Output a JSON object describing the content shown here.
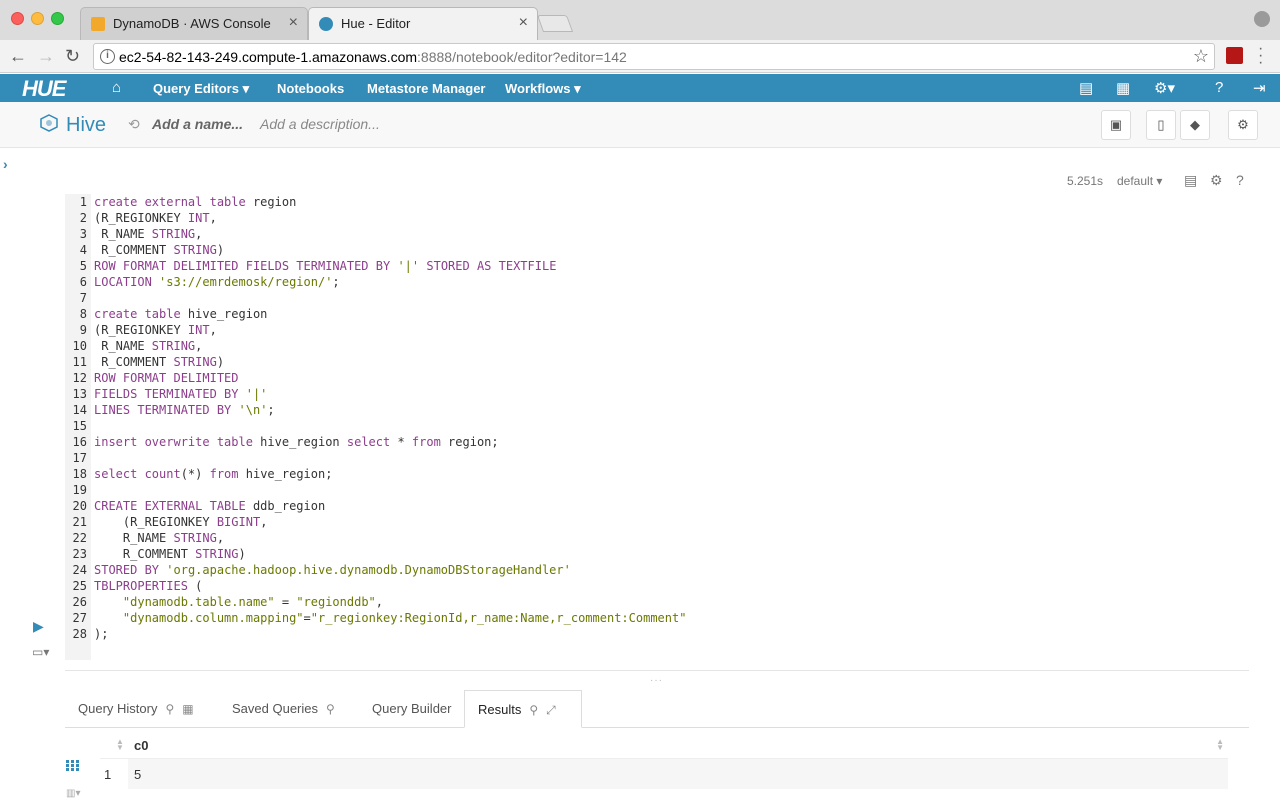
{
  "browser": {
    "tabs": [
      {
        "label": "DynamoDB · AWS Console",
        "icon": "aws-cube-icon"
      },
      {
        "label": "Hue - Editor",
        "icon": "hue-icon"
      }
    ],
    "url_host": "ec2-54-82-143-249.compute-1.amazonaws.com",
    "url_rest": ":8888/notebook/editor?editor=142"
  },
  "hue_nav": {
    "logo": "HUE",
    "items": [
      "Query Editors",
      "Notebooks",
      "Metastore Manager",
      "Workflows"
    ]
  },
  "editor": {
    "title": "Hive",
    "name_placeholder": "Add a name...",
    "description_placeholder": "Add a description..."
  },
  "snippet": {
    "elapsed": "5.251s",
    "database": "default"
  },
  "code_lines": [
    [
      [
        "kw",
        "create external table"
      ],
      [
        "t",
        " region"
      ]
    ],
    [
      [
        "t",
        "(R_REGIONKEY "
      ],
      [
        "kw",
        "INT"
      ],
      [
        "t",
        ","
      ]
    ],
    [
      [
        "t",
        " R_NAME "
      ],
      [
        "kw",
        "STRING"
      ],
      [
        "t",
        ","
      ]
    ],
    [
      [
        "t",
        " R_COMMENT "
      ],
      [
        "kw",
        "STRING"
      ],
      [
        "t",
        ")"
      ]
    ],
    [
      [
        "kw",
        "ROW FORMAT DELIMITED FIELDS TERMINATED BY"
      ],
      [
        "t",
        " "
      ],
      [
        "str",
        "'|'"
      ],
      [
        "t",
        " "
      ],
      [
        "kw",
        "STORED AS TEXTFILE"
      ]
    ],
    [
      [
        "kw",
        "LOCATION"
      ],
      [
        "t",
        " "
      ],
      [
        "str",
        "'s3://emrdemosk/region/'"
      ],
      [
        "t",
        ";"
      ]
    ],
    [],
    [
      [
        "kw",
        "create table"
      ],
      [
        "t",
        " hive_region"
      ]
    ],
    [
      [
        "t",
        "(R_REGIONKEY "
      ],
      [
        "kw",
        "INT"
      ],
      [
        "t",
        ","
      ]
    ],
    [
      [
        "t",
        " R_NAME "
      ],
      [
        "kw",
        "STRING"
      ],
      [
        "t",
        ","
      ]
    ],
    [
      [
        "t",
        " R_COMMENT "
      ],
      [
        "kw",
        "STRING"
      ],
      [
        "t",
        ")"
      ]
    ],
    [
      [
        "kw",
        "ROW FORMAT DELIMITED"
      ]
    ],
    [
      [
        "kw",
        "FIELDS TERMINATED BY"
      ],
      [
        "t",
        " "
      ],
      [
        "str",
        "'|'"
      ]
    ],
    [
      [
        "kw",
        "LINES TERMINATED BY"
      ],
      [
        "t",
        " "
      ],
      [
        "str",
        "'\\n'"
      ],
      [
        "t",
        ";"
      ]
    ],
    [],
    [
      [
        "kw",
        "insert overwrite table"
      ],
      [
        "t",
        " hive_region "
      ],
      [
        "kw",
        "select"
      ],
      [
        "t",
        " * "
      ],
      [
        "kw",
        "from"
      ],
      [
        "t",
        " region;"
      ]
    ],
    [],
    [
      [
        "kw",
        "select count"
      ],
      [
        "t",
        "(*) "
      ],
      [
        "kw",
        "from"
      ],
      [
        "t",
        " hive_region;"
      ]
    ],
    [],
    [
      [
        "kw",
        "CREATE EXTERNAL TABLE"
      ],
      [
        "t",
        " ddb_region"
      ]
    ],
    [
      [
        "t",
        "    (R_REGIONKEY "
      ],
      [
        "kw",
        "BIGINT"
      ],
      [
        "t",
        ","
      ]
    ],
    [
      [
        "t",
        "    R_NAME "
      ],
      [
        "kw",
        "STRING"
      ],
      [
        "t",
        ","
      ]
    ],
    [
      [
        "t",
        "    R_COMMENT "
      ],
      [
        "kw",
        "STRING"
      ],
      [
        "t",
        ")"
      ]
    ],
    [
      [
        "kw",
        "STORED BY"
      ],
      [
        "t",
        " "
      ],
      [
        "str",
        "'org.apache.hadoop.hive.dynamodb.DynamoDBStorageHandler'"
      ]
    ],
    [
      [
        "kw",
        "TBLPROPERTIES"
      ],
      [
        "t",
        " ("
      ]
    ],
    [
      [
        "t",
        "    "
      ],
      [
        "str",
        "\"dynamodb.table.name\""
      ],
      [
        "t",
        " = "
      ],
      [
        "str",
        "\"regionddb\""
      ],
      [
        "t",
        ","
      ]
    ],
    [
      [
        "t",
        "    "
      ],
      [
        "str",
        "\"dynamodb.column.mapping\""
      ],
      [
        "t",
        "="
      ],
      [
        "str",
        "\"r_regionkey:RegionId,r_name:Name,r_comment:Comment\""
      ]
    ],
    [
      [
        "t",
        ");"
      ]
    ]
  ],
  "bottom_tabs": [
    {
      "label": "Query History"
    },
    {
      "label": "Saved Queries"
    },
    {
      "label": "Query Builder"
    },
    {
      "label": "Results"
    }
  ],
  "results": {
    "columns": [
      "c0"
    ],
    "rows": [
      [
        "1",
        "5"
      ]
    ]
  },
  "colors": {
    "hue_blue": "#338bb8",
    "keyword": "#8c3e8c",
    "string": "#6c7900"
  }
}
